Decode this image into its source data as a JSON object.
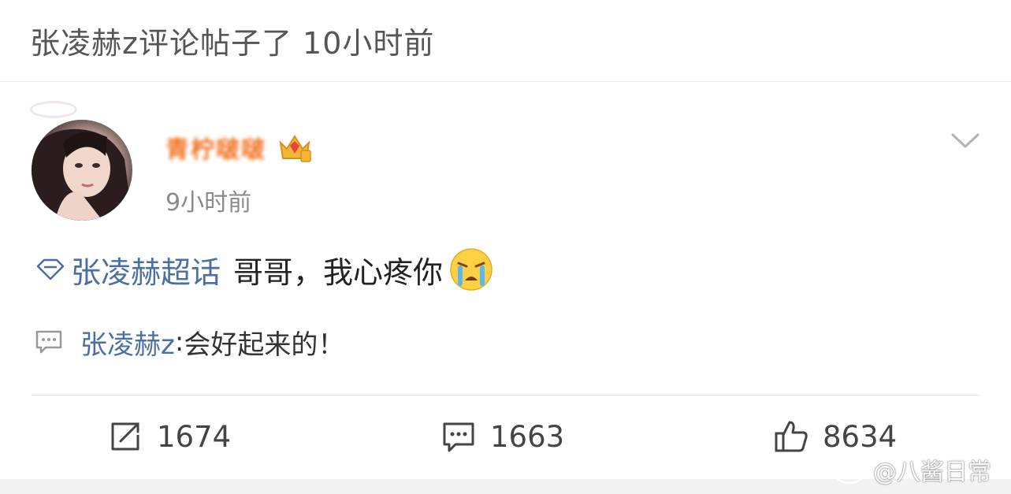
{
  "header": {
    "title": "张凌赫z评论帖子了 10小时前"
  },
  "post": {
    "username": "青柠啵啵",
    "time_ago": "9小时前",
    "topic": "张凌赫超话",
    "body": "哥哥，我心疼你",
    "icons": {
      "badge": "crown-icon",
      "more": "chevron-down-icon",
      "topic": "diamond-topic-icon",
      "emoji": "crying-emoji-icon"
    }
  },
  "reply": {
    "author": "张凌赫z",
    "separator": ": ",
    "text": "会好起来的！"
  },
  "actions": {
    "repost_count": "1674",
    "comment_count": "1663",
    "like_count": "8634"
  },
  "watermark": {
    "text": "@八酱日常"
  },
  "colors": {
    "link": "#4a6fa2",
    "username": "#f16f1c",
    "muted": "#8a8a8a"
  }
}
